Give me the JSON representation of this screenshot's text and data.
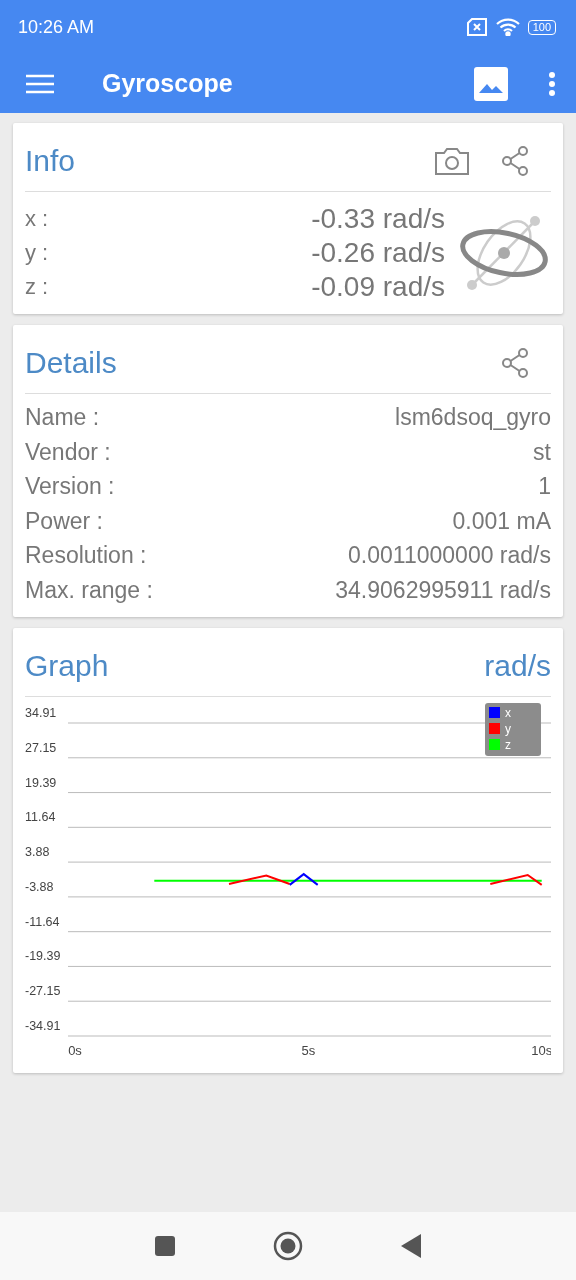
{
  "status_bar": {
    "time": "10:26 AM",
    "battery": "100"
  },
  "app_bar": {
    "title": "Gyroscope"
  },
  "info": {
    "title": "Info",
    "rows": [
      {
        "label": "x :",
        "value": "-0.33 rad/s"
      },
      {
        "label": "y :",
        "value": "-0.26 rad/s"
      },
      {
        "label": "z :",
        "value": "-0.09 rad/s"
      }
    ]
  },
  "details": {
    "title": "Details",
    "rows": [
      {
        "label": "Name :",
        "value": "lsm6dsoq_gyro"
      },
      {
        "label": "Vendor :",
        "value": "st"
      },
      {
        "label": "Version :",
        "value": "1"
      },
      {
        "label": "Power :",
        "value": "0.001 mA"
      },
      {
        "label": "Resolution :",
        "value": "0.0011000000 rad/s"
      },
      {
        "label": "Max. range :",
        "value": "34.9062995911 rad/s"
      }
    ]
  },
  "graph": {
    "title": "Graph",
    "unit": "rad/s",
    "chart_data": {
      "type": "line",
      "grid": true,
      "legend": "upper right",
      "x": [
        1.7,
        2.5,
        3.3,
        4.1,
        4.6,
        4.9,
        5.2,
        5.7,
        6.5,
        7.3,
        8.1,
        8.9,
        9.7,
        10
      ],
      "series": [
        {
          "name": "x",
          "color": "#0000ff",
          "values": [
            null,
            null,
            null,
            null,
            -1.2,
            1.2,
            -1.2,
            null,
            null,
            null,
            null,
            null,
            null,
            null
          ]
        },
        {
          "name": "y",
          "color": "#ff0000",
          "values": [
            null,
            null,
            -1.0,
            0.9,
            -1.0,
            null,
            null,
            null,
            null,
            null,
            null,
            -1.0,
            1.0,
            -1.2
          ]
        },
        {
          "name": "z",
          "color": "#00ff00",
          "values": [
            -0.3,
            -0.3,
            -0.3,
            -0.3,
            -0.3,
            -0.3,
            -0.3,
            -0.3,
            -0.3,
            -0.3,
            -0.3,
            -0.3,
            -0.3,
            -0.3
          ]
        }
      ],
      "xlim": [
        -0.15,
        10.2
      ],
      "ylim": [
        -34.91,
        34.91
      ],
      "xticks": [
        {
          "value": 0,
          "label": "0s"
        },
        {
          "value": 5,
          "label": "5s"
        },
        {
          "value": 10,
          "label": "10s"
        }
      ],
      "yticks": [
        34.91,
        27.15,
        19.39,
        11.64,
        3.88,
        -3.88,
        -11.64,
        -19.39,
        -27.15,
        -34.91
      ]
    }
  }
}
